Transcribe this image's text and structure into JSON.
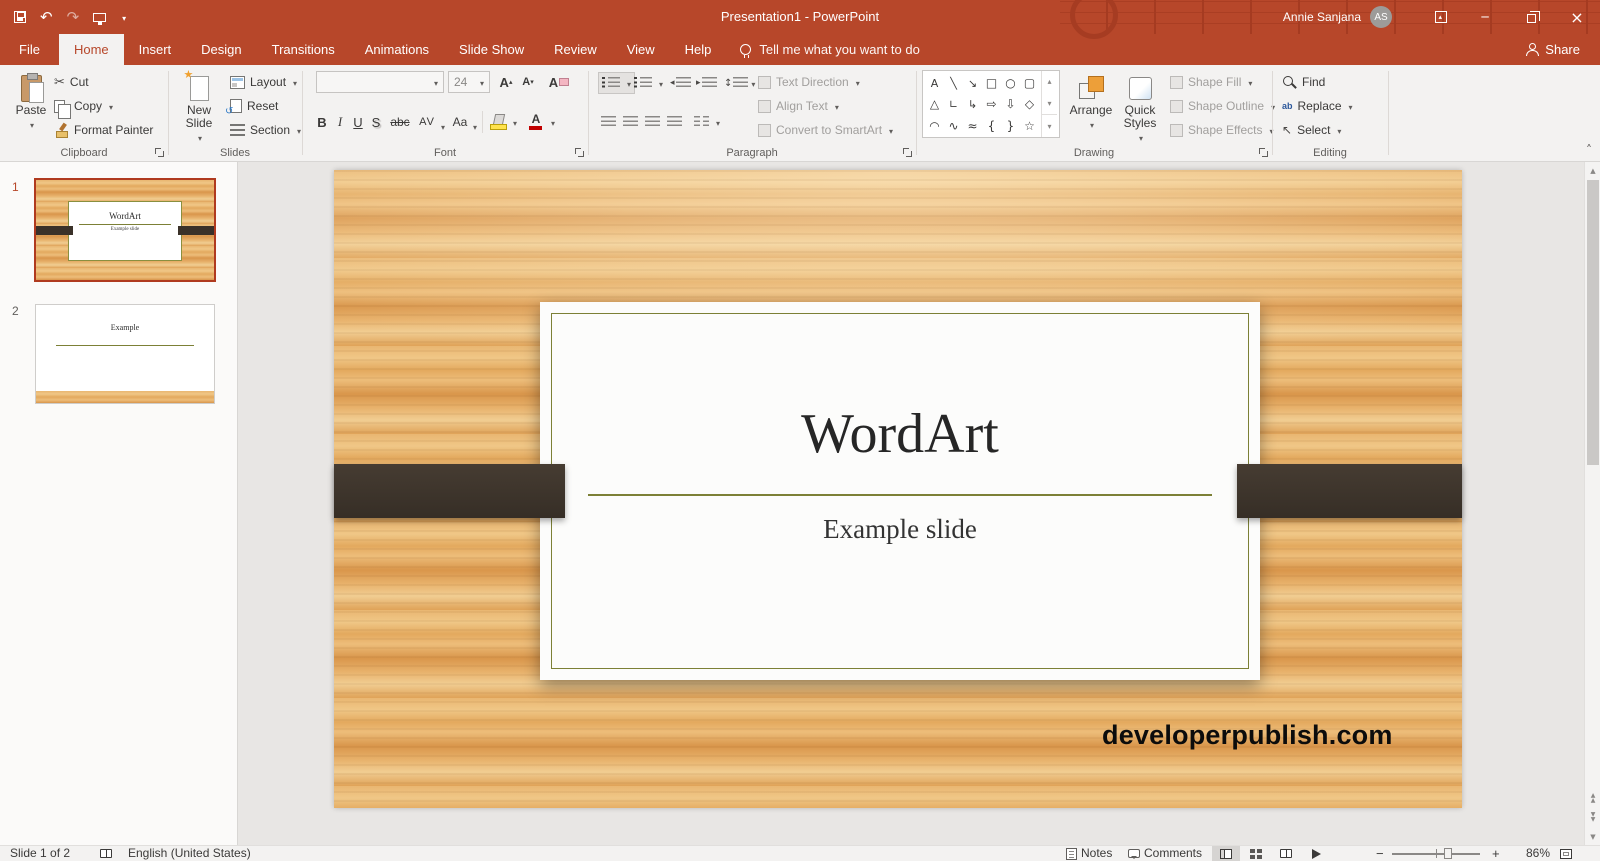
{
  "titlebar": {
    "title": "Presentation1  -  PowerPoint",
    "user_name": "Annie Sanjana",
    "user_initials": "AS"
  },
  "tabs": {
    "file": "File",
    "items": [
      "Home",
      "Insert",
      "Design",
      "Transitions",
      "Animations",
      "Slide Show",
      "Review",
      "View",
      "Help"
    ],
    "tell_me": "Tell me what you want to do",
    "share": "Share"
  },
  "clipboard": {
    "label": "Clipboard",
    "paste": "Paste",
    "cut": "Cut",
    "copy": "Copy",
    "format_painter": "Format Painter"
  },
  "slides_group": {
    "label": "Slides",
    "new_slide": "New Slide",
    "layout": "Layout",
    "reset": "Reset",
    "section": "Section"
  },
  "font_group": {
    "label": "Font",
    "font_name": "",
    "font_size": "24",
    "bold": "B",
    "italic": "I",
    "underline": "U",
    "shadow": "S",
    "strikethrough": "abc",
    "char_spacing": "AV",
    "change_case": "Aa"
  },
  "paragraph_group": {
    "label": "Paragraph",
    "text_direction": "Text Direction",
    "align_text": "Align Text",
    "smartart": "Convert to SmartArt"
  },
  "drawing_group": {
    "label": "Drawing",
    "arrange": "Arrange",
    "quick_styles": "Quick Styles",
    "shape_fill": "Shape Fill",
    "shape_outline": "Shape Outline",
    "shape_effects": "Shape Effects"
  },
  "editing_group": {
    "label": "Editing",
    "find": "Find",
    "replace": "Replace",
    "select": "Select"
  },
  "thumbnails": [
    {
      "number": "1",
      "title": "WordArt",
      "subtitle": "Example slide"
    },
    {
      "number": "2",
      "title": "Example"
    }
  ],
  "slide": {
    "title": "WordArt",
    "subtitle": "Example slide",
    "watermark": "developerpublish.com"
  },
  "statusbar": {
    "slide_info": "Slide 1 of 2",
    "language": "English (United States)",
    "notes": "Notes",
    "comments": "Comments",
    "zoom": "86%"
  },
  "colors": {
    "brand": "#b7472a",
    "olive": "#7c8036",
    "banner": "#3a3129",
    "wood_light": "#f0c787",
    "wood_dark": "#d9964b"
  }
}
